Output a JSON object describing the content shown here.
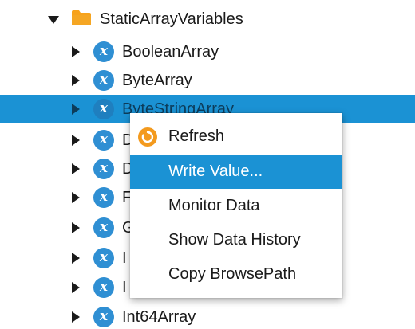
{
  "tree": {
    "folder": {
      "label": "StaticArrayVariables",
      "icon": "folder-icon",
      "color": "#f7a21b"
    },
    "items": [
      {
        "label": "BooleanArray",
        "icon": "variable-icon"
      },
      {
        "label": "ByteArray",
        "icon": "variable-icon"
      },
      {
        "label": "ByteStringArray",
        "icon": "variable-icon",
        "selected": true
      },
      {
        "label": "D",
        "icon": "variable-icon"
      },
      {
        "label": "D",
        "icon": "variable-icon"
      },
      {
        "label": "F",
        "icon": "variable-icon"
      },
      {
        "label": "G",
        "icon": "variable-icon"
      },
      {
        "label": "I",
        "icon": "variable-icon"
      },
      {
        "label": "I",
        "icon": "variable-icon"
      },
      {
        "label": "Int64Array",
        "icon": "variable-icon"
      }
    ],
    "variable_icon_glyph": "x"
  },
  "context_menu": {
    "items": [
      {
        "label": "Refresh",
        "icon": "refresh-icon"
      },
      {
        "label": "Write Value...",
        "highlighted": true
      },
      {
        "label": "Monitor Data"
      },
      {
        "label": "Show Data History"
      },
      {
        "label": "Copy BrowsePath"
      }
    ]
  },
  "colors": {
    "selection": "#1b92d4",
    "variable_icon": "#2f8fd3",
    "folder": "#f7a21b",
    "refresh_icon": "#f39a1e"
  }
}
